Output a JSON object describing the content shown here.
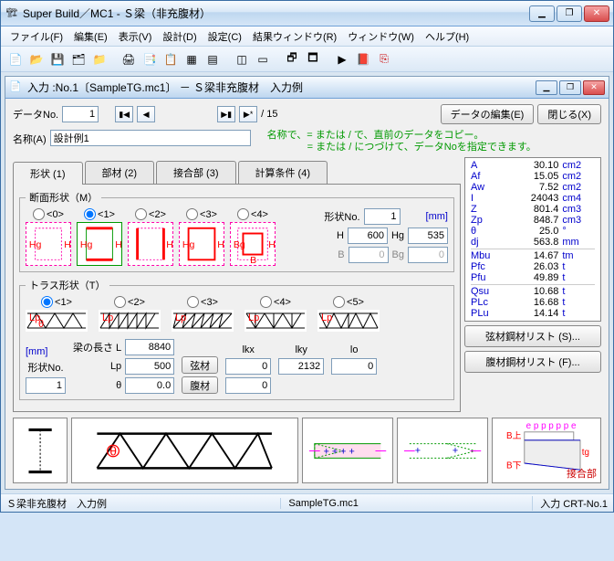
{
  "window": {
    "title": "Super Build／MC1 - Ｓ梁（非充腹材）",
    "icons": {
      "min": "▁",
      "max": "❐",
      "close": "✕"
    }
  },
  "menu": {
    "file": "ファイル(F)",
    "edit": "編集(E)",
    "view": "表示(V)",
    "design": "設計(D)",
    "settings": "設定(C)",
    "result": "結果ウィンドウ(R)",
    "window": "ウィンドウ(W)",
    "help": "ヘルプ(H)"
  },
  "mdi": {
    "title": "入力 :No.1〔SampleTG.mc1〕 － Ｓ梁非充腹材　入力例"
  },
  "topbar": {
    "data_no_label": "データNo.",
    "data_no": "1",
    "total": "/ 15",
    "edit_data_btn": "データの編集(E)",
    "close_btn": "閉じる(X)",
    "name_label": "名称(A)",
    "name": "設計例1",
    "hint1": "名称で、= または / で、直前のデータをコピー。",
    "hint2": "　　　　= または / につづけて、データNoを指定できます。"
  },
  "tabs": {
    "t1": "形状 (1)",
    "t2": "部材 (2)",
    "t3": "接合部 (3)",
    "t4": "計算条件 (4)"
  },
  "section": {
    "legend": "断面形状（M）",
    "opts": [
      "<0>",
      "<1>",
      "<2>",
      "<3>",
      "<4>"
    ],
    "shape_no_label": "形状No.",
    "shape_no": "1",
    "unit": "[mm]",
    "H_label": "H",
    "H": "600",
    "Hg_label": "Hg",
    "Hg": "535",
    "B_label": "B",
    "B": "0",
    "Bg_label": "Bg",
    "Bg": "0"
  },
  "truss": {
    "legend": "トラス形状（T）",
    "opts": [
      "<1>",
      "<2>",
      "<3>",
      "<4>",
      "<5>"
    ],
    "unit": "[mm]",
    "shape_no_label": "形状No.",
    "shape_no": "1",
    "L_label": "梁の長さ L",
    "L": "8840",
    "Lp_label": "Lp",
    "Lp": "500",
    "theta_label": "θ",
    "theta": "0.0",
    "chord_btn": "弦材",
    "web_btn": "腹材",
    "lkx_label": "lkx",
    "lkx": "0",
    "lky_label": "lky",
    "lky": "2132",
    "lo_label": "lo",
    "lo": "0"
  },
  "info": {
    "rows1": [
      {
        "k": "A",
        "v": "30.10",
        "u": "cm2"
      },
      {
        "k": "Af",
        "v": "15.05",
        "u": "cm2"
      },
      {
        "k": "Aw",
        "v": "7.52",
        "u": "cm2"
      },
      {
        "k": "I",
        "v": "24043",
        "u": "cm4"
      },
      {
        "k": "Z",
        "v": "801.4",
        "u": "cm3"
      },
      {
        "k": "Zp",
        "v": "848.7",
        "u": "cm3"
      },
      {
        "k": "θ",
        "v": "25.0",
        "u": "°"
      },
      {
        "k": "dj",
        "v": "563.8",
        "u": "mm"
      }
    ],
    "rows2": [
      {
        "k": "Mbu",
        "v": "14.67",
        "u": "tm"
      },
      {
        "k": "Pfc",
        "v": "26.03",
        "u": "t"
      },
      {
        "k": "Pfu",
        "v": "49.89",
        "u": "t"
      }
    ],
    "rows3": [
      {
        "k": "Qsu",
        "v": "10.68",
        "u": "t"
      },
      {
        "k": "PLc",
        "v": "16.68",
        "u": "t"
      },
      {
        "k": "PLu",
        "v": "14.14",
        "u": "t"
      }
    ]
  },
  "list_btns": {
    "chord": "弦材鋼材リスト (S)...",
    "web": "腹材鋼材リスト (F)..."
  },
  "joint": {
    "label": "接合部",
    "Bu": "B上",
    "Bd": "B下"
  },
  "status": {
    "s1": "Ｓ梁非充腹材　入力例",
    "s2": "SampleTG.mc1",
    "s3": "入力 CRT-No.1"
  }
}
